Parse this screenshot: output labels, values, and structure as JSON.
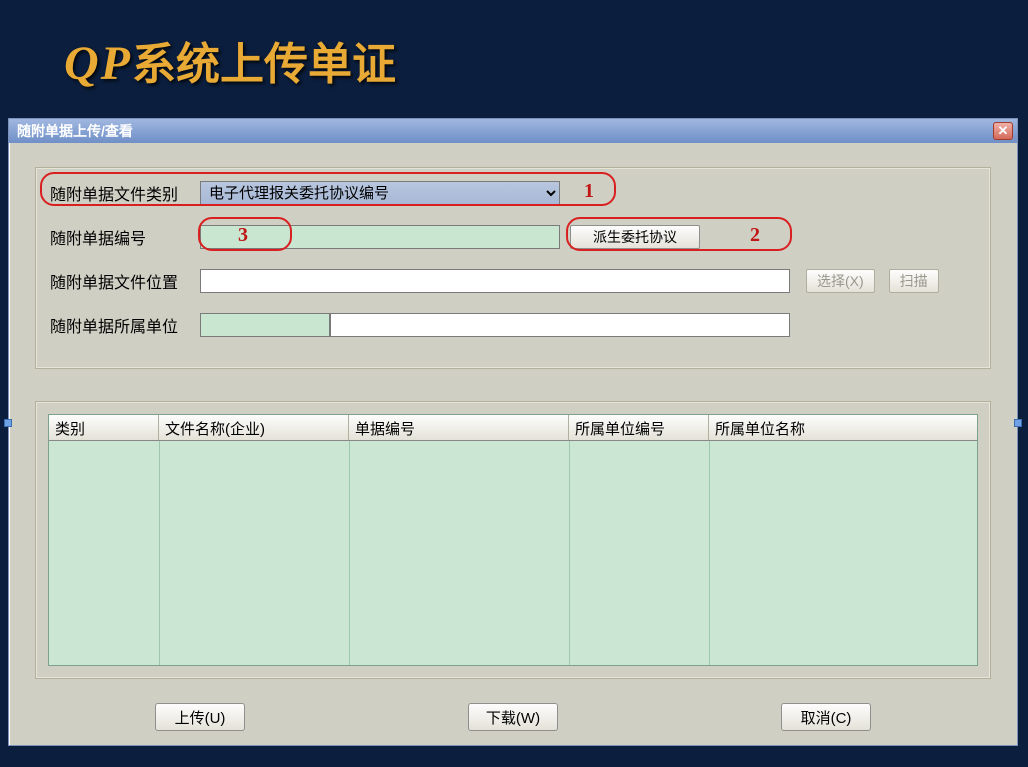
{
  "slide": {
    "title_prefix": "QP",
    "title_rest": "系统上传单证"
  },
  "dialog": {
    "title": "随附单据上传/查看"
  },
  "form": {
    "file_type_label": "随附单据文件类别",
    "file_type_value": "电子代理报关委托协议编号",
    "doc_no_label": "随附单据编号",
    "doc_no_value": "",
    "derive_button": "派生委托协议",
    "file_pos_label": "随附单据文件位置",
    "file_pos_value": "",
    "select_button": "选择(X)",
    "scan_button": "扫描",
    "company_label": "随附单据所属单位",
    "company_code": "",
    "company_name": ""
  },
  "callouts": {
    "one": "1",
    "two": "2",
    "three": "3"
  },
  "grid": {
    "columns": [
      "类别",
      "文件名称(企业)",
      "单据编号",
      "所属单位编号",
      "所属单位名称"
    ]
  },
  "footer": {
    "upload": "上传(U)",
    "download": "下载(W)",
    "cancel": "取消(C)"
  }
}
